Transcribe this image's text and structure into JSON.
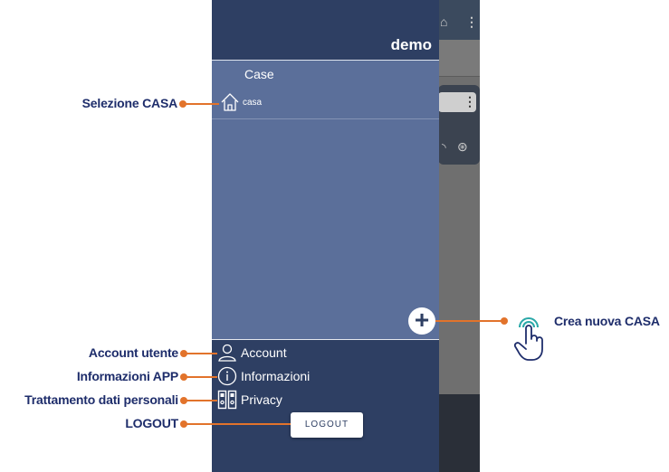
{
  "drawer": {
    "title": "demo",
    "houses_label": "Case",
    "houses": [
      {
        "name": "casa",
        "icon": "house-icon"
      }
    ],
    "add_icon": "plus-icon",
    "menu": [
      {
        "label": "Account",
        "icon": "user-icon"
      },
      {
        "label": "Informazioni",
        "icon": "info-icon"
      },
      {
        "label": "Privacy",
        "icon": "privacy-icon"
      }
    ],
    "logout_label": "LOGOUT"
  },
  "annotations": {
    "select_house": "Selezione CASA",
    "create_house": "Crea nuova CASA",
    "account": "Account utente",
    "info": "Informazioni APP",
    "privacy": "Trattamento dati personali",
    "logout": "LOGOUT"
  },
  "colors": {
    "drawer_header": "#2e3f63",
    "drawer_body": "#5b6f9a",
    "annotation_text": "#1e2d6b",
    "annotation_accent": "#e2732b"
  }
}
